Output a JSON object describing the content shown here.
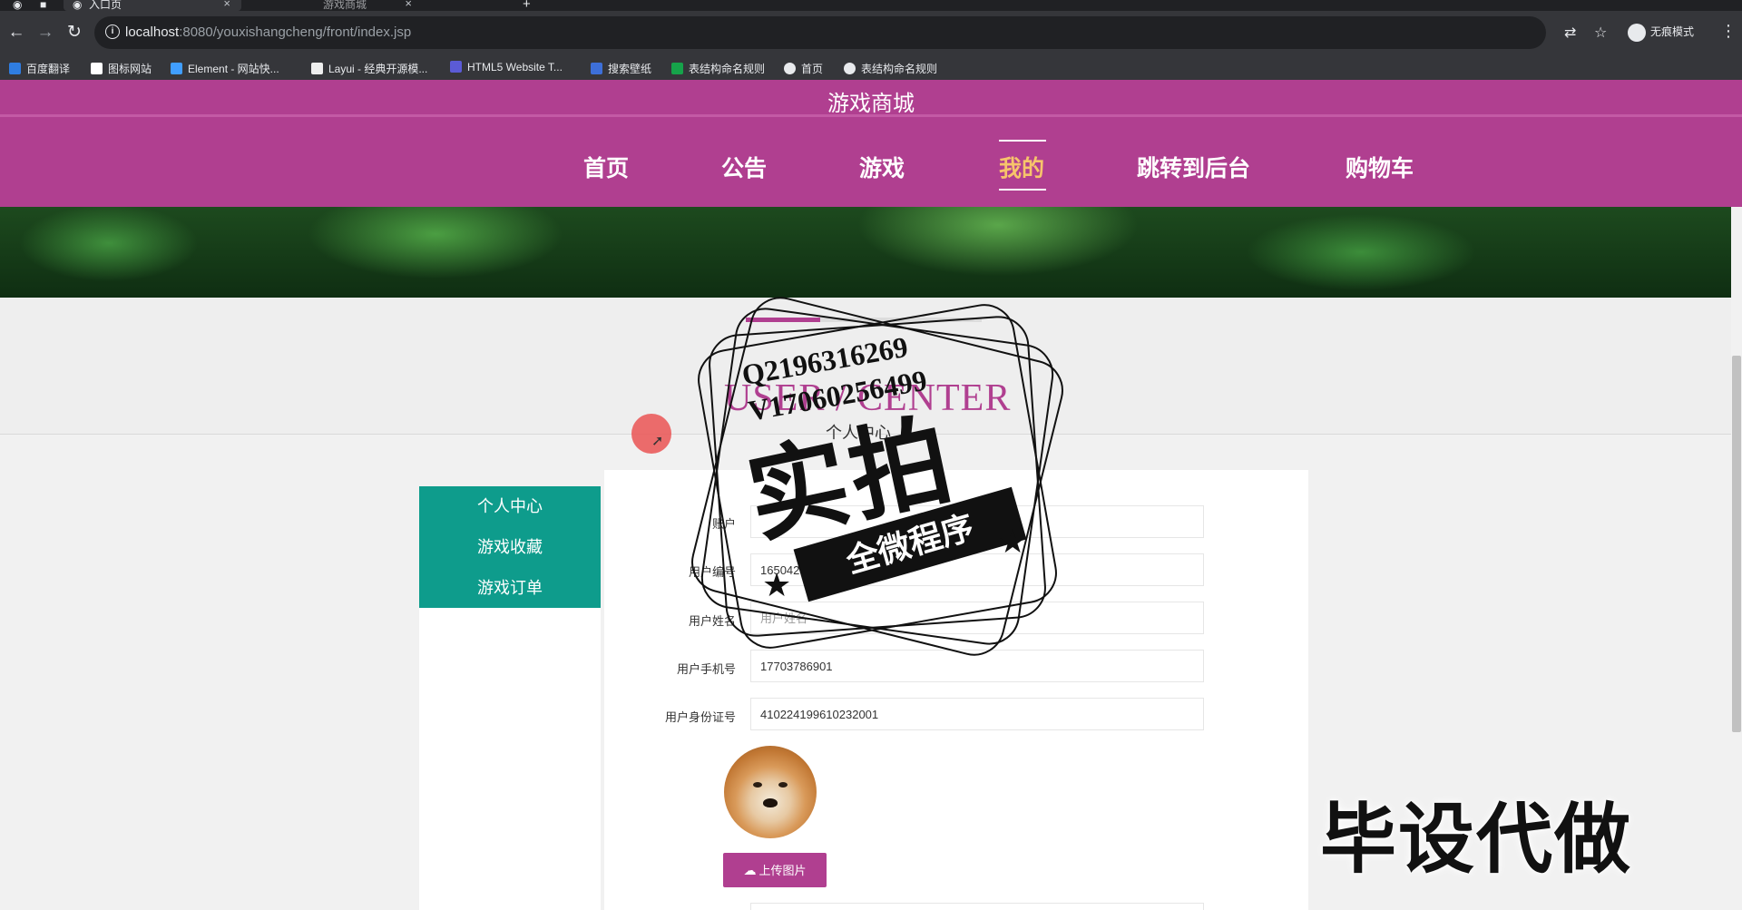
{
  "browser": {
    "tabs": [
      {
        "label": "入口页",
        "active": true
      },
      {
        "label": "游戏商城",
        "active": false
      }
    ],
    "new_tab": "+",
    "tab_close": "×",
    "url_host": "localhost",
    "url_path": ":8080/youxishangcheng/front/index.jsp",
    "incognito_label": "无痕模式",
    "bookmarks": [
      {
        "label": "百度翻译",
        "color": "#2f7de1"
      },
      {
        "label": "图标网站",
        "color": "#ffffff"
      },
      {
        "label": "Element - 网站快...",
        "color": "#409eff"
      },
      {
        "label": "Layui - 经典开源模...",
        "color": "#eeeeee"
      },
      {
        "label": "HTML5 Website T...",
        "color": "#5b5bd6"
      },
      {
        "label": "搜索壁纸",
        "color": "#3d6fd8"
      },
      {
        "label": "表结构命名规则",
        "color": "#16a34a"
      },
      {
        "label": "首页",
        "color": "#e8eaed"
      },
      {
        "label": "表结构命名规则",
        "color": "#e8eaed"
      }
    ]
  },
  "site": {
    "title": "游戏商城",
    "nav": [
      {
        "label": "首页",
        "active": false
      },
      {
        "label": "公告",
        "active": false
      },
      {
        "label": "游戏",
        "active": false
      },
      {
        "label": "我的",
        "active": true
      },
      {
        "label": "跳转到后台",
        "active": false
      },
      {
        "label": "购物车",
        "active": false
      }
    ],
    "brand_color": "#b03f90",
    "active_color": "#f7c46b"
  },
  "section": {
    "title_en": "USER / CENTER",
    "title_cn": "个人中心"
  },
  "sidebar": {
    "color": "#0e9c8c",
    "items": [
      {
        "label": "个人中心"
      },
      {
        "label": "游戏收藏"
      },
      {
        "label": "游戏订单"
      }
    ]
  },
  "form": {
    "fields": [
      {
        "label": "账户",
        "value": ""
      },
      {
        "label": "用户编号",
        "value": "16504255..."
      },
      {
        "label": "用户姓名",
        "value": "用户姓名"
      },
      {
        "label": "用户手机号",
        "value": "17703786901"
      },
      {
        "label": "用户身份证号",
        "value": "410224199610232001"
      }
    ],
    "avatar_icon": "shiba-avatar",
    "upload_icon": "cloud-upload-icon",
    "upload_label": "上传图片"
  },
  "overlay": {
    "contact_qq": "Q2196316269",
    "contact_v": "V17060256499",
    "stamp_main": "实拍",
    "stamp_ribbon": "全微程序",
    "watermark": "毕设代做"
  }
}
